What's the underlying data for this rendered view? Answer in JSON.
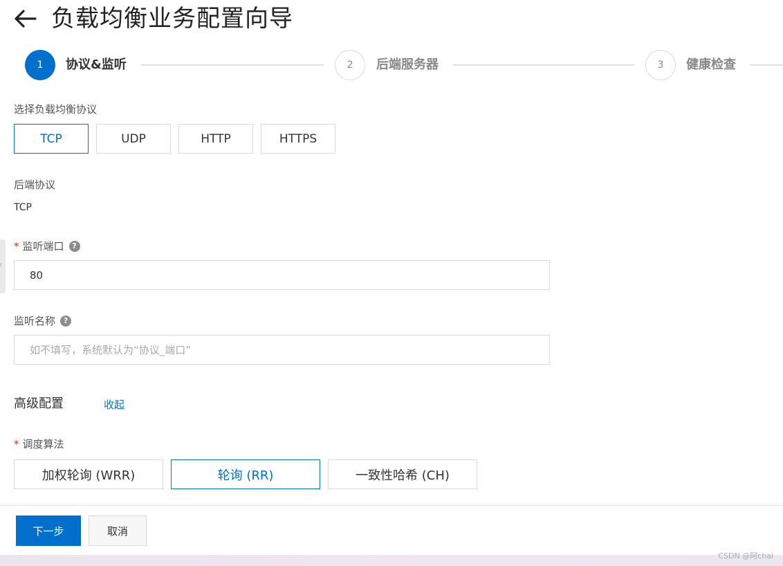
{
  "header": {
    "title": "负载均衡业务配置向导"
  },
  "steps": [
    {
      "num": "1",
      "label": "协议&监听",
      "state": "active"
    },
    {
      "num": "2",
      "label": "后端服务器",
      "state": "inactive"
    },
    {
      "num": "3",
      "label": "健康检查",
      "state": "inactive"
    }
  ],
  "protocol": {
    "label": "选择负载均衡协议",
    "options": [
      "TCP",
      "UDP",
      "HTTP",
      "HTTPS"
    ],
    "selected": "TCP"
  },
  "backend_protocol": {
    "label": "后端协议",
    "value": "TCP"
  },
  "listen_port": {
    "required_mark": "*",
    "label": "监听端口",
    "help": "?",
    "value": "80"
  },
  "listen_name": {
    "label": "监听名称",
    "help": "?",
    "placeholder": "如不填写，系统默认为“协议_端口”"
  },
  "advanced": {
    "title": "高级配置",
    "toggle": "收起"
  },
  "scheduling": {
    "required_mark": "*",
    "label": "调度算法",
    "options": [
      "加权轮询 (WRR)",
      "轮询 (RR)",
      "一致性哈希 (CH)"
    ],
    "selected": "轮询 (RR)"
  },
  "footer": {
    "next": "下一步",
    "cancel": "取消"
  },
  "watermark": "CSDN @阿chai",
  "colors": {
    "primary": "#0070cc",
    "required": "#e0281f",
    "border": "#d9d9d9"
  },
  "icons": {
    "back": "arrow-left-icon",
    "help": "question-circle-icon",
    "side_tab": "chevron-left-icon"
  }
}
